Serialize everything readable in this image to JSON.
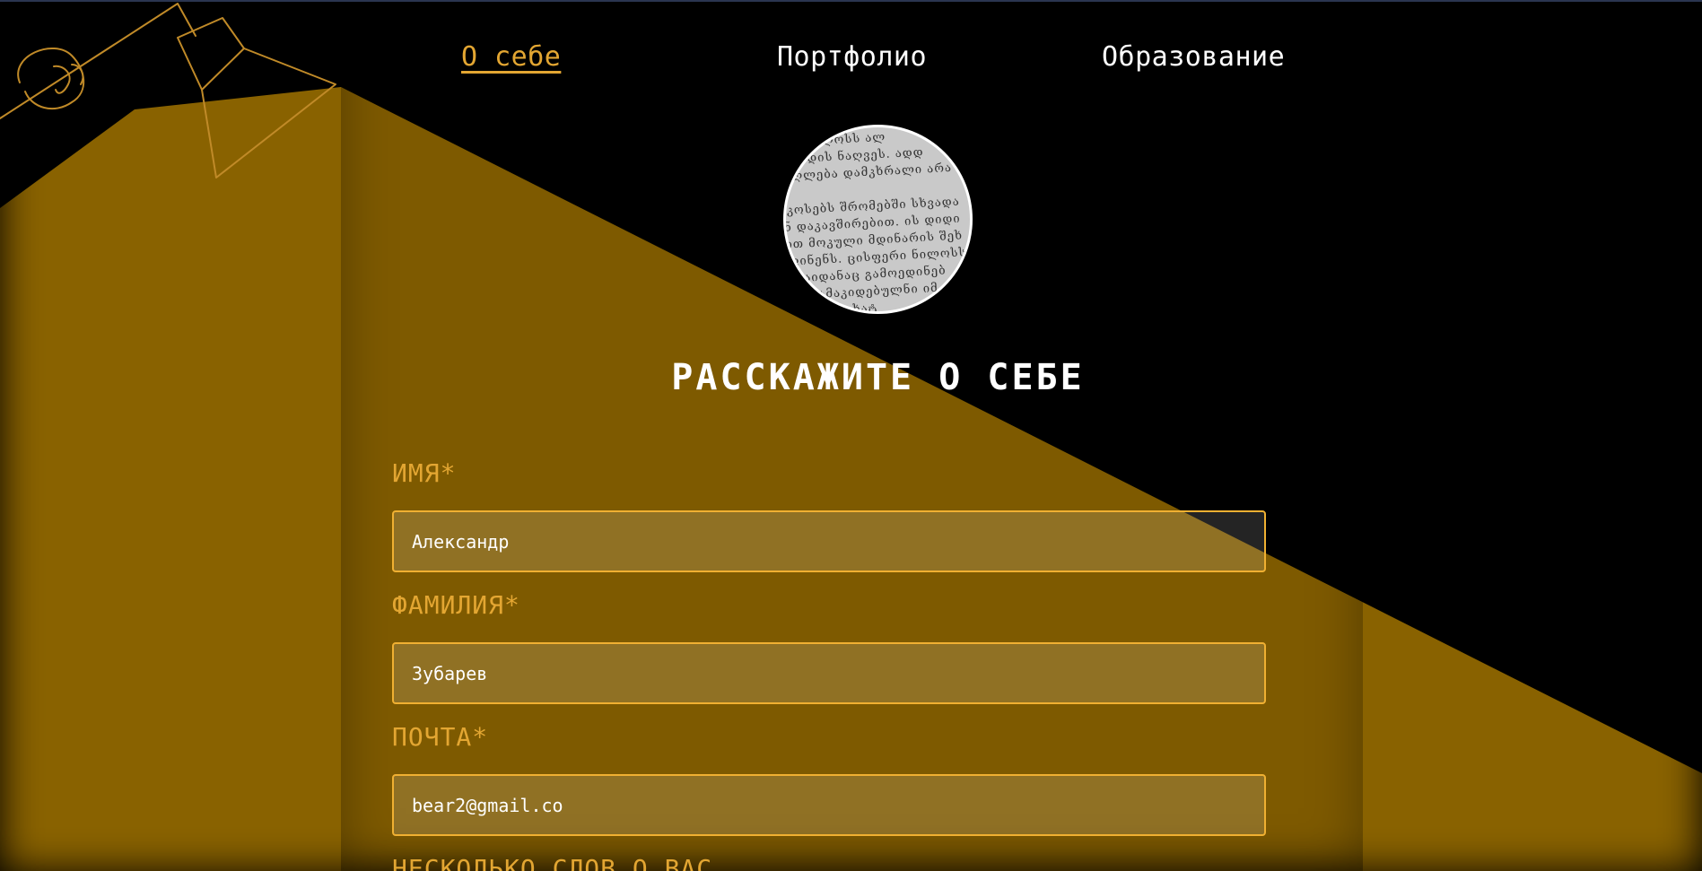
{
  "nav": {
    "items": [
      {
        "label": "О себе",
        "active": true
      },
      {
        "label": "Портфолио",
        "active": false
      },
      {
        "label": "Образование",
        "active": false
      }
    ]
  },
  "avatar": {
    "text_lines": [
      "ჯგა. ნილოსს ალ",
      "ო მოდის ნაღვეს. ადდ",
      "ადღლება დამკხრალი არა",
      "",
      "ოკოსებს შრომებში სხვადა",
      "ან დაკავშირებით. ის დიდი",
      "ბით მოკული მდინარის შეხ",
      "ოფინენს. ცისფერი ნილოსს",
      "ა, საიდანაც გამოედინებ",
      "ბეჩ დამაკიდებულნი იმ",
      "ახით გამოხატ"
    ]
  },
  "form": {
    "title": "РАССКАЖИТЕ О СЕБЕ",
    "first_name": {
      "label": "ИМЯ*",
      "value": "Александр"
    },
    "last_name": {
      "label": "ФАМИЛИЯ*",
      "value": "Зубарев"
    },
    "email": {
      "label": "ПОЧТА*",
      "value": "bear2@gmail.co"
    },
    "about": {
      "label": "НЕСКОЛЬКО СЛОВ О ВАС"
    }
  },
  "colors": {
    "accent": "#e3a632",
    "field_border": "#f0b032",
    "beam": "#8c6400",
    "background": "#000000"
  }
}
